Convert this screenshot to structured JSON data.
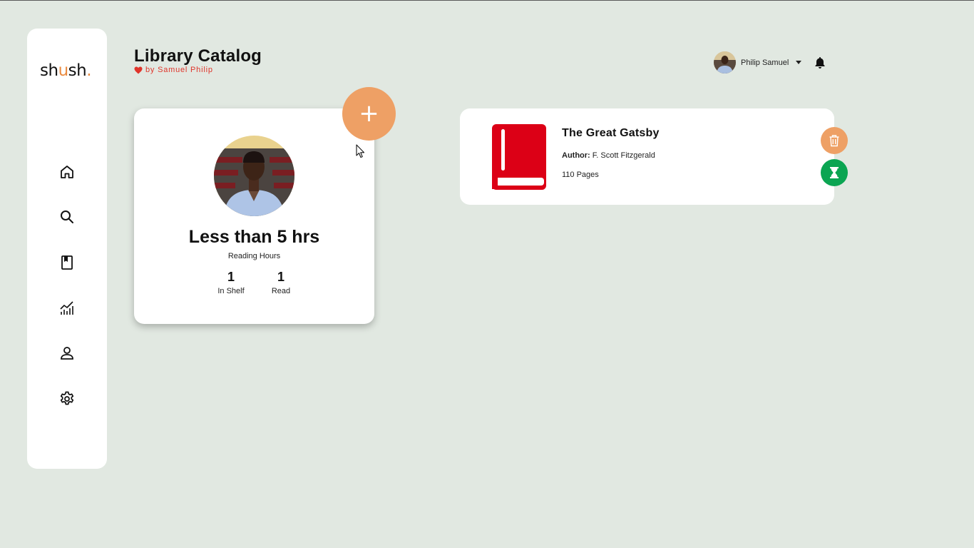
{
  "app": {
    "logo_prefix": "sh",
    "logo_accent": "u",
    "logo_suffix": "sh",
    "logo_dot": "."
  },
  "colors": {
    "background": "#e1e8e1",
    "accent_orange": "#eea065",
    "accent_green": "#0ba552",
    "book_red": "#dc0016",
    "byline_red": "#e0352b"
  },
  "sidebar": {
    "items": [
      {
        "name": "home",
        "icon": "home-icon"
      },
      {
        "name": "search",
        "icon": "search-icon"
      },
      {
        "name": "books",
        "icon": "book-icon"
      },
      {
        "name": "stats",
        "icon": "chart-icon"
      },
      {
        "name": "profile",
        "icon": "user-icon"
      },
      {
        "name": "settings",
        "icon": "gear-icon"
      }
    ]
  },
  "header": {
    "title": "Library Catalog",
    "byline": "by Samuel Philip",
    "user_name": "Philip Samuel"
  },
  "profile_card": {
    "reading_hours": "Less than 5 hrs",
    "reading_hours_label": "Reading Hours",
    "stats": [
      {
        "value": "1",
        "label": "In Shelf"
      },
      {
        "value": "1",
        "label": "Read"
      }
    ],
    "add_label": "+"
  },
  "books": [
    {
      "title": "The Great Gatsby",
      "author_label": "Author:",
      "author": "F. Scott Fitzgerald",
      "pages": "110 Pages"
    }
  ]
}
